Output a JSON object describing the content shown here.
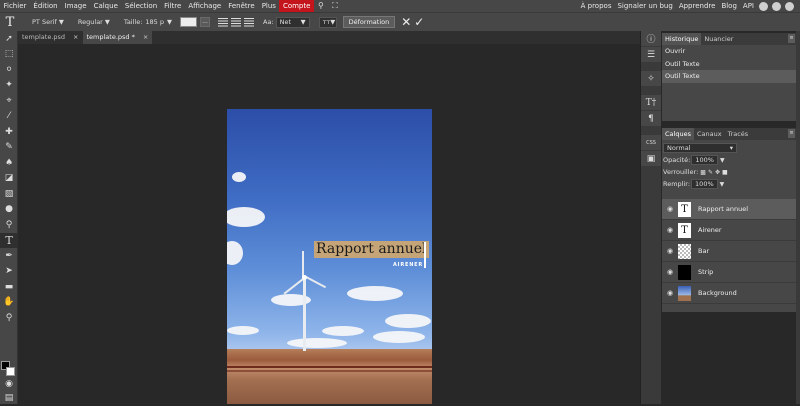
{
  "menu": {
    "items": [
      "Fichier",
      "Édition",
      "Image",
      "Calque",
      "Sélection",
      "Filtre",
      "Affichage",
      "Fenêtre",
      "Plus",
      "Compte"
    ],
    "right_links": [
      "À propos",
      "Signaler un bug",
      "Apprendre",
      "Blog",
      "API"
    ],
    "accent_color": "#c4141c"
  },
  "options": {
    "tool_glyph": "T",
    "font": "PT Serif ▼",
    "style": "Regular ▼",
    "size_label": "Taille:",
    "size_value": "185 p",
    "size_arrow": "▼",
    "more": "...",
    "aa_label": "Aa:",
    "aa_value": "Net",
    "aa_arrow": "▼",
    "tt": "тт",
    "tt_arrow": "▼",
    "warp_button": "Déformation",
    "cancel": "✕",
    "confirm": "✓"
  },
  "tabs": [
    {
      "label": "template.psd",
      "close": "×"
    },
    {
      "label": "template.psd *",
      "close": "×"
    }
  ],
  "canvas": {
    "title": "Rapport annuel",
    "subtitle": "AIRENER",
    "title_bg": "#c5a577"
  },
  "history": {
    "tabs": [
      "Historique",
      "Nuancier"
    ],
    "items": [
      "Ouvrir",
      "Outil Texte",
      "Outil Texte"
    ],
    "menu_glyph": "≡"
  },
  "layers_panel": {
    "tabs": [
      "Calques",
      "Canaux",
      "Tracés"
    ],
    "blend_mode": "Normal",
    "opacity_label": "Opacité:",
    "opacity_value": "100%",
    "lock_label": "Verrouiller:",
    "fill_label": "Remplir:",
    "fill_value": "100%",
    "menu_glyph": "≡",
    "layers": [
      {
        "name": "Rapport annuel",
        "thumb": "T",
        "selected": true
      },
      {
        "name": "Airener",
        "thumb": "T",
        "selected": false
      },
      {
        "name": "Bar",
        "thumb": "",
        "selected": false
      },
      {
        "name": "Strip",
        "thumb": "",
        "selected": false
      },
      {
        "name": "Background",
        "thumb": "",
        "selected": false
      }
    ]
  }
}
